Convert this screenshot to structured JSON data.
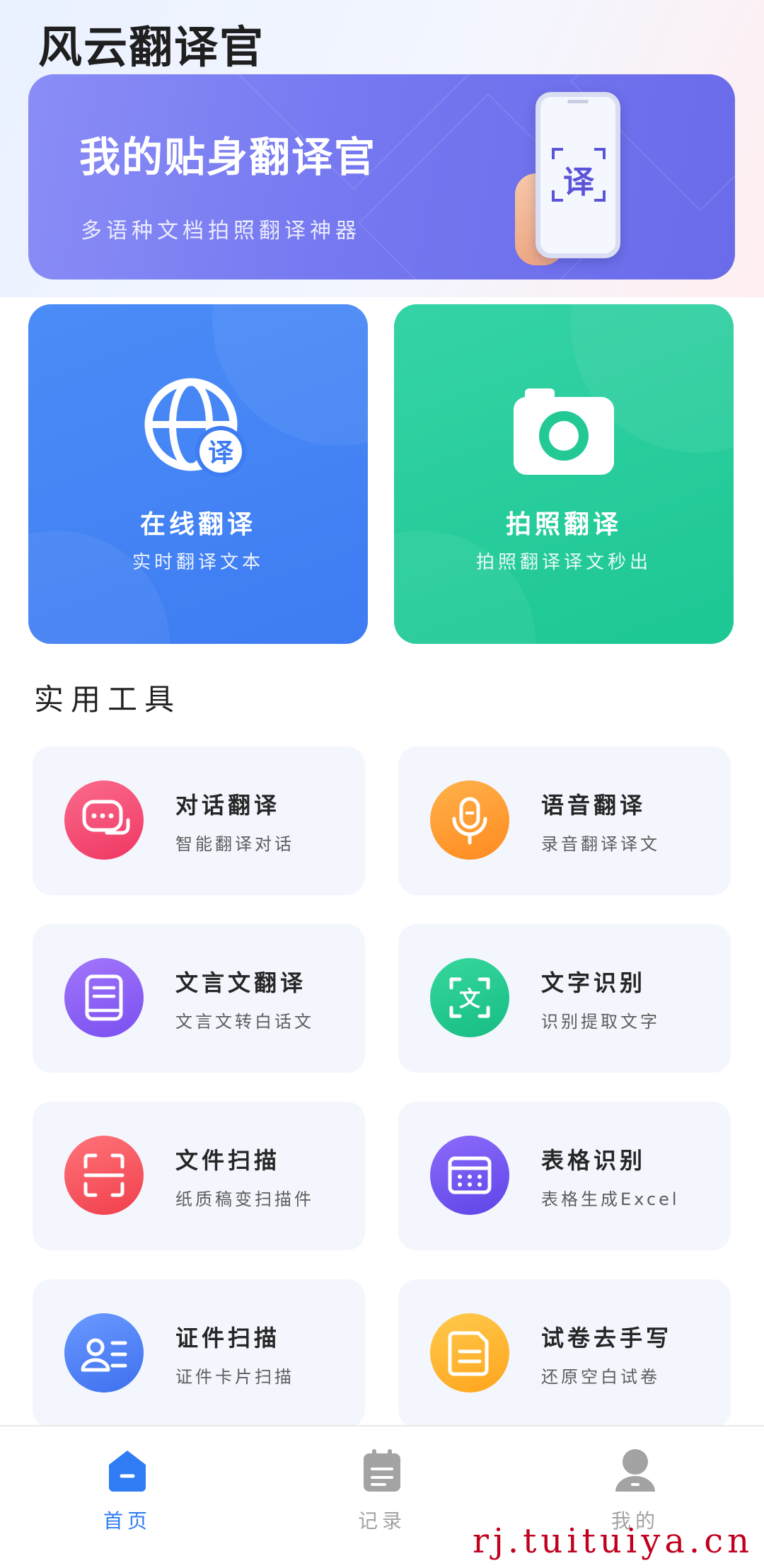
{
  "app": {
    "title": "风云翻译官"
  },
  "banner": {
    "title": "我的贴身翻译官",
    "subtitle": "多语种文档拍照翻译神器",
    "phone_glyph": "译"
  },
  "feature_cards": [
    {
      "title": "在线翻译",
      "subtitle": "实时翻译文本",
      "icon": "globe-translate-icon",
      "color": "#4287f5",
      "glyph": "译"
    },
    {
      "title": "拍照翻译",
      "subtitle": "拍照翻译译文秒出",
      "icon": "camera-icon",
      "color": "#22c995"
    }
  ],
  "tools_section": {
    "title": "实用工具"
  },
  "tools": [
    {
      "name": "对话翻译",
      "desc": "智能翻译对话",
      "icon": "chat-bubble-icon",
      "color": "#f3466d"
    },
    {
      "name": "语音翻译",
      "desc": "录音翻译译文",
      "icon": "microphone-icon",
      "color": "#ff9a2e"
    },
    {
      "name": "文言文翻译",
      "desc": "文言文转白话文",
      "icon": "book-icon",
      "color": "#8a5cf5"
    },
    {
      "name": "文字识别",
      "desc": "识别提取文字",
      "icon": "text-scan-icon",
      "color": "#20c98f",
      "glyph": "文"
    },
    {
      "name": "文件扫描",
      "desc": "纸质稿变扫描件",
      "icon": "document-scan-icon",
      "color": "#f5505a"
    },
    {
      "name": "表格识别",
      "desc": "表格生成Excel",
      "icon": "table-icon",
      "color": "#7357f0"
    },
    {
      "name": "证件扫描",
      "desc": "证件卡片扫描",
      "icon": "id-card-icon",
      "color": "#4a7df5"
    },
    {
      "name": "试卷去手写",
      "desc": "还原空白试卷",
      "icon": "paper-icon",
      "color": "#ffb12e"
    }
  ],
  "tabbar": {
    "items": [
      {
        "label": "首页",
        "icon": "home-icon",
        "active": true
      },
      {
        "label": "记录",
        "icon": "records-icon",
        "active": false
      },
      {
        "label": "我的",
        "icon": "profile-icon",
        "active": false
      }
    ],
    "active_color": "#2f7cf4",
    "inactive_color": "#a3a3a3"
  },
  "watermark": "rj.tuituiya.cn"
}
